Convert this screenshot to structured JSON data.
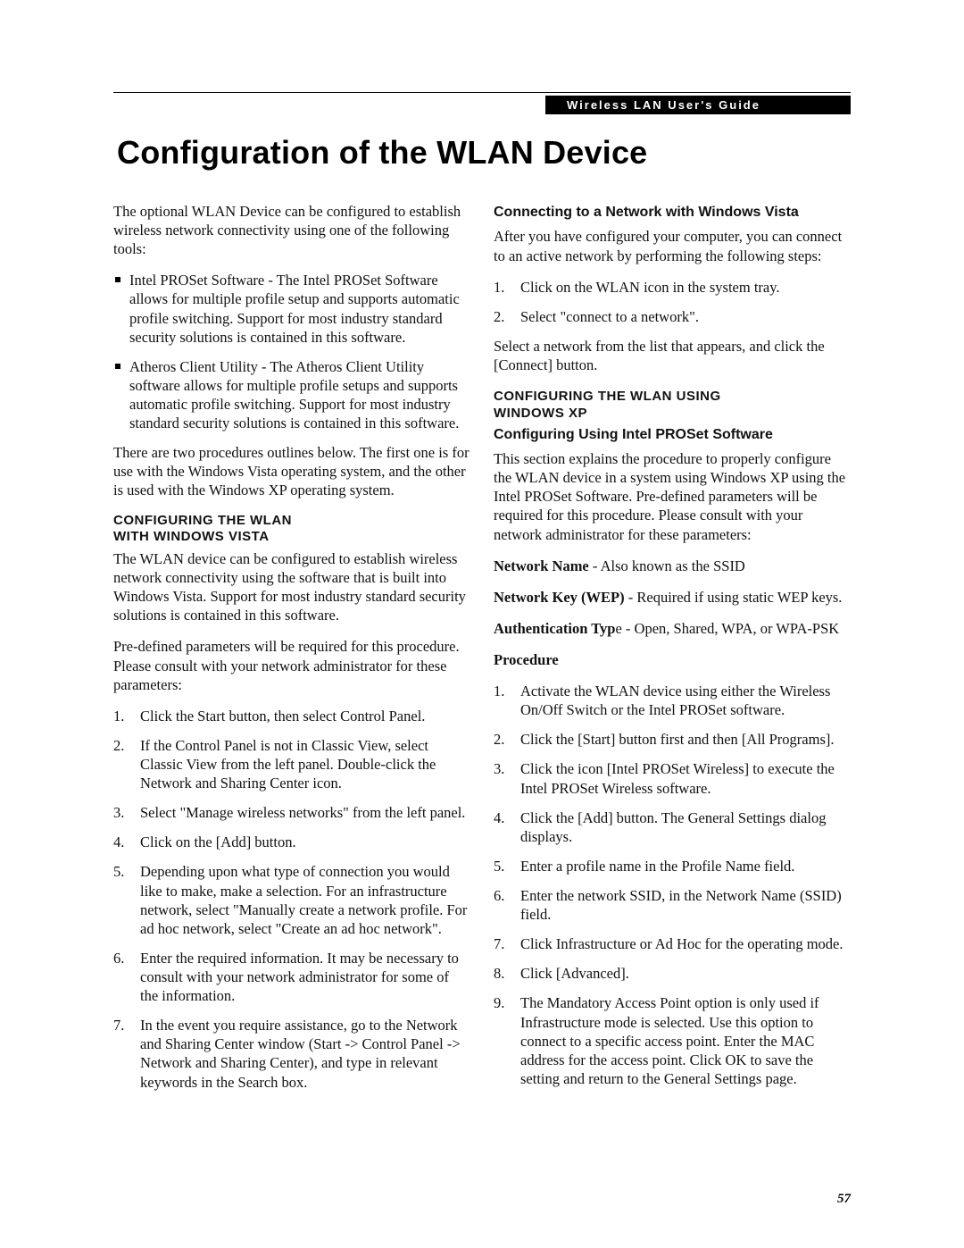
{
  "header_bar": "Wireless LAN User's Guide",
  "title": "Configuration of the WLAN Device",
  "page_number": "57",
  "left": {
    "intro": "The optional WLAN Device can be configured to establish wireless network connectivity using one of the following tools:",
    "tools": [
      "Intel PROSet Software - The Intel PROSet Software allows for multiple profile setup and supports automatic profile switching. Support for most industry standard security solutions is contained in this software.",
      "Atheros Client Utility - The Atheros Client Utility software allows for multiple profile setups and supports automatic profile switching. Support for most industry standard security solutions is contained in this software."
    ],
    "two_proc": "There are two procedures outlines below. The first one is for use with the Windows Vista operating system, and the other is used with the Windows XP operating system.",
    "vista_heading_l1": "CONFIGURING THE WLAN",
    "vista_heading_l2": "WITH WINDOWS VISTA",
    "vista_intro1": "The WLAN device can be configured to establish wireless network connectivity using the software that is built into Windows Vista. Support for most industry standard security solutions is contained in this software.",
    "vista_intro2": "Pre-defined parameters will be required for this procedure. Please consult with your network administrator for these parameters:",
    "vista_steps": [
      "Click the Start button, then select Control Panel.",
      "If the Control Panel is not in Classic View, select Classic View from the left panel. Double-click the Network and Sharing Center icon.",
      "Select \"Manage wireless networks\" from the left panel.",
      "Click on the [Add] button.",
      "Depending upon what type of connection you would like to make, make a selection. For an infrastructure network, select \"Manually create a network profile. For ad hoc network, select \"Create an ad hoc network\".",
      "Enter the required information. It may be necessary to consult with your network administrator for some of the information.",
      "In the event you require assistance, go to the Network and Sharing Center window (Start -> Control Panel -> Network and Sharing Center), and type in relevant keywords in the Search box."
    ]
  },
  "right": {
    "connect_heading": "Connecting to a Network with Windows Vista",
    "connect_intro": "After you have configured your computer, you can connect to an active network by performing the following steps:",
    "connect_steps": [
      "Click on the WLAN icon in the system tray.",
      "Select \"connect to a network\"."
    ],
    "connect_tail": "Select a network from the list that appears, and click the [Connect] button.",
    "xp_heading_l1": "CONFIGURING THE WLAN USING",
    "xp_heading_l2": "WINDOWS XP",
    "xp_sub": "Configuring Using Intel PROSet Software",
    "xp_intro": "This section explains the procedure to properly configure the WLAN device in a system using Windows XP using the Intel PROSet Software. Pre-defined parameters will be required for this procedure. Please consult with your network administrator for these parameters:",
    "net_name_label": "Network Name",
    "net_name_desc": " - Also known as the SSID",
    "net_key_label": "Network Key (WEP)",
    "net_key_desc": " - Required if using static WEP keys.",
    "auth_label": "Authentication Typ",
    "auth_desc": "e - Open, Shared, WPA, or WPA-PSK",
    "procedure_heading": "Procedure",
    "xp_steps": [
      "Activate the WLAN device using either the Wireless On/Off Switch or the Intel PROSet software.",
      "Click the [Start] button first and then [All Programs].",
      "Click the icon [Intel PROSet Wireless] to execute the Intel PROSet Wireless software.",
      "Click the [Add] button. The General Settings dialog displays.",
      "Enter a profile name in the Profile Name field.",
      "Enter the network SSID, in the Network Name (SSID) field.",
      "Click Infrastructure or Ad Hoc for the operating mode.",
      "Click [Advanced].",
      "The Mandatory Access Point option is only used if Infrastructure mode is selected. Use this option to connect to a specific access point. Enter the MAC address for the access point. Click OK to save the setting and return to the General Settings page."
    ]
  }
}
